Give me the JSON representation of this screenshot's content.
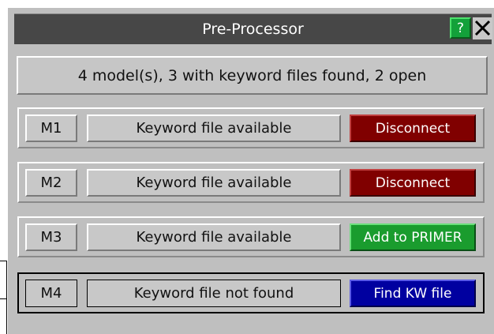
{
  "window": {
    "title": "Pre-Processor",
    "help_label": "?"
  },
  "summary": "4 model(s), 3 with keyword files found, 2 open",
  "models": [
    {
      "id": "M1",
      "status": "Keyword file available",
      "action": "Disconnect"
    },
    {
      "id": "M2",
      "status": "Keyword file available",
      "action": "Disconnect"
    },
    {
      "id": "M3",
      "status": "Keyword file available",
      "action": "Add to PRIMER"
    },
    {
      "id": "M4",
      "status": "Keyword file not found",
      "action": "Find KW file"
    }
  ],
  "colors": {
    "titlebar": "#474747",
    "panel": "#bfbfbf",
    "disconnect": "#800000",
    "add": "#1a9c2e",
    "find": "#0000a0",
    "help": "#13a13a"
  },
  "icons": {
    "close": "close-icon",
    "help": "help-icon"
  }
}
